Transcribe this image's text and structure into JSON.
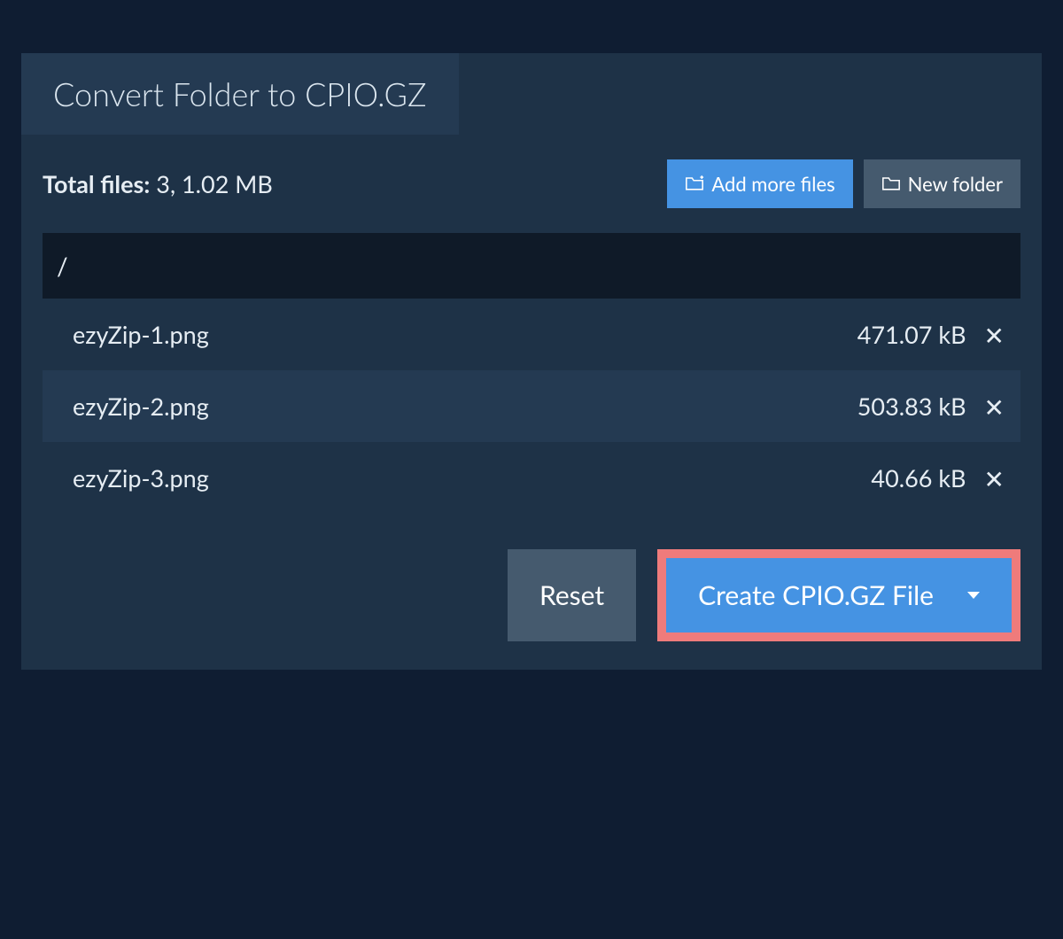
{
  "tab_title": "Convert Folder to CPIO.GZ",
  "total_label": "Total files:",
  "total_value": "3, 1.02 MB",
  "add_more_label": "Add more files",
  "new_folder_label": "New folder",
  "path_header": "/",
  "files": [
    {
      "name": "ezyZip-1.png",
      "size": "471.07 kB"
    },
    {
      "name": "ezyZip-2.png",
      "size": "503.83 kB"
    },
    {
      "name": "ezyZip-3.png",
      "size": "40.66 kB"
    }
  ],
  "reset_label": "Reset",
  "create_label": "Create CPIO.GZ File"
}
